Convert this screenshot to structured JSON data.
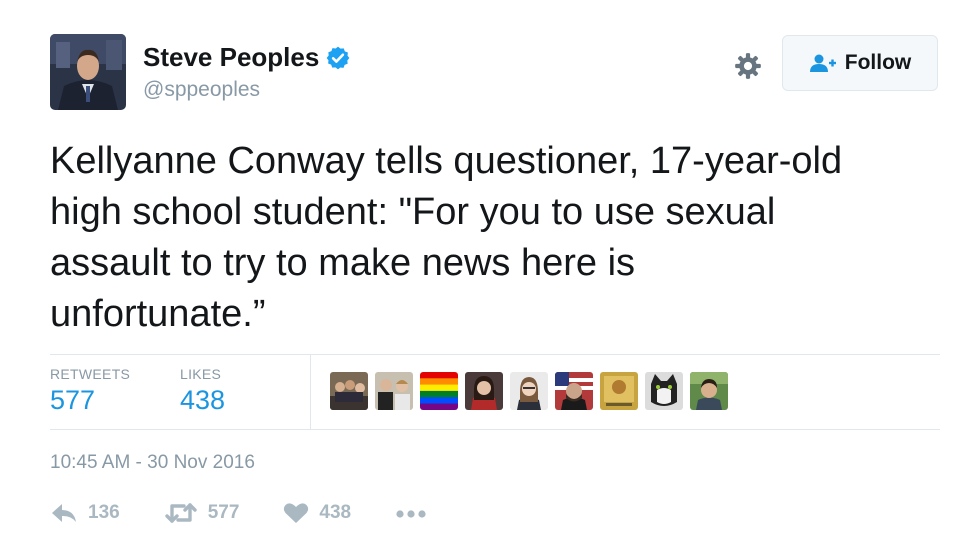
{
  "author": {
    "name": "Steve Peoples",
    "handle": "@sppeoples",
    "verified": true
  },
  "follow_button": {
    "label": "Follow"
  },
  "tweet": {
    "lines": [
      "Kellyanne Conway tells questioner, 17-year-old",
      "high school student: \"For you to use sexual",
      "assault to try to make news here is",
      "unfortunate.”"
    ]
  },
  "stats": {
    "retweets_label": "RETWEETS",
    "retweets": "577",
    "likes_label": "LIKES",
    "likes": "438"
  },
  "likers": [
    "avatar-group",
    "avatar-couple",
    "avatar-rainbow",
    "avatar-woman-red",
    "avatar-woman-glasses",
    "avatar-man-flag",
    "avatar-yellow-art",
    "avatar-cat",
    "avatar-man-outdoor"
  ],
  "timestamp": "10:45 AM - 30 Nov 2016",
  "actions": {
    "reply_count": "136",
    "retweet_count": "577",
    "like_count": "438"
  },
  "icons": {
    "verified": "verified-badge-icon",
    "gear": "gear-icon",
    "follow": "add-user-icon",
    "reply": "reply-icon",
    "retweet": "retweet-icon",
    "like": "heart-icon",
    "more": "more-icon"
  },
  "colors": {
    "accent": "#1b95e0",
    "muted": "#8899a6",
    "icon": "#aab8c2",
    "text": "#14171a",
    "verified": "#1da1f2"
  }
}
